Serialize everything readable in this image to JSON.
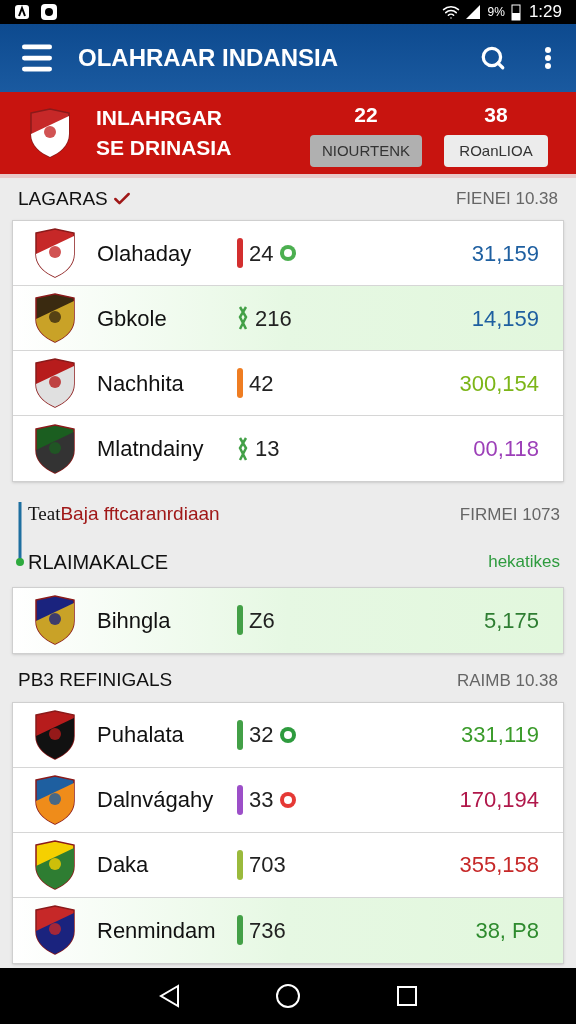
{
  "status_bar": {
    "battery": "9%",
    "time": "1:29"
  },
  "app_bar": {
    "title": "OLAHRAAR INDANSIA"
  },
  "banner": {
    "title_lines": [
      "INLAHRGAR",
      "SE DRINASIA"
    ],
    "stats": [
      {
        "value": "22",
        "label": "NIOURTENK",
        "selected": true
      },
      {
        "value": "38",
        "label": "ROanLIOA",
        "selected": false
      }
    ]
  },
  "sections": [
    {
      "title": "LAGARAS",
      "checked": true,
      "date": "FIENEI 10.38",
      "rows": [
        {
          "name": "Olahaday",
          "kind": "bar",
          "color": "#d32f2f",
          "value": "24",
          "badge": {
            "color": "#4caf50"
          },
          "total": {
            "text": "31,159",
            "color": "#1e5fa0"
          },
          "highlighted": false
        },
        {
          "name": "Gbkole",
          "kind": "squiggle",
          "color": "#43a047",
          "value": "216",
          "total": {
            "text": "14,159",
            "color": "#1e5fa0"
          },
          "highlighted": true
        },
        {
          "name": "Nachhita",
          "kind": "bar",
          "color": "#ef7d22",
          "value": "42",
          "total": {
            "text": "300,154",
            "color": "#7cb518"
          },
          "highlighted": false
        },
        {
          "name": "Mlatndainy",
          "kind": "squiggle",
          "color": "#43a047",
          "value": "13",
          "total": {
            "text": "00,118",
            "color": "#9c3fb8"
          },
          "highlighted": false
        }
      ]
    },
    {
      "prefix": "Teat",
      "title": "Baja fftcaranrdiaan",
      "date": "FIRMEI 1073",
      "subtitle": "RLAIMAKALCE",
      "link": "hekatikes",
      "rows": [
        {
          "name": "Bihngla",
          "kind": "bar",
          "color": "#43a047",
          "value": "Z6",
          "total": {
            "text": "5,175",
            "color": "#2e7d32"
          },
          "highlighted": true
        }
      ]
    },
    {
      "title": "PB3 REFINIGALS",
      "date": "RAIMB 10.38",
      "rows": [
        {
          "name": "Puhalata",
          "kind": "bar",
          "color": "#43a047",
          "value": "32",
          "badge": {
            "color": "#2e9b3e"
          },
          "total": {
            "text": "331,119",
            "color": "#3a9b2a"
          },
          "highlighted": false
        },
        {
          "name": "Dalnvágahy",
          "kind": "bar",
          "color": "#9c4fc8",
          "value": "33",
          "badge": {
            "color": "#e53935"
          },
          "total": {
            "text": "170,194",
            "color": "#b0174a"
          },
          "highlighted": false
        },
        {
          "name": "Daka",
          "kind": "bar",
          "color": "#9aba3c",
          "value": "703",
          "total": {
            "text": "355,158",
            "color": "#c62828"
          },
          "highlighted": false
        },
        {
          "name": "Renmindam",
          "kind": "bar",
          "color": "#43a047",
          "value": "736",
          "total": {
            "text": "38, P8",
            "color": "#2e8b2e"
          },
          "highlighted": true
        }
      ]
    }
  ]
}
